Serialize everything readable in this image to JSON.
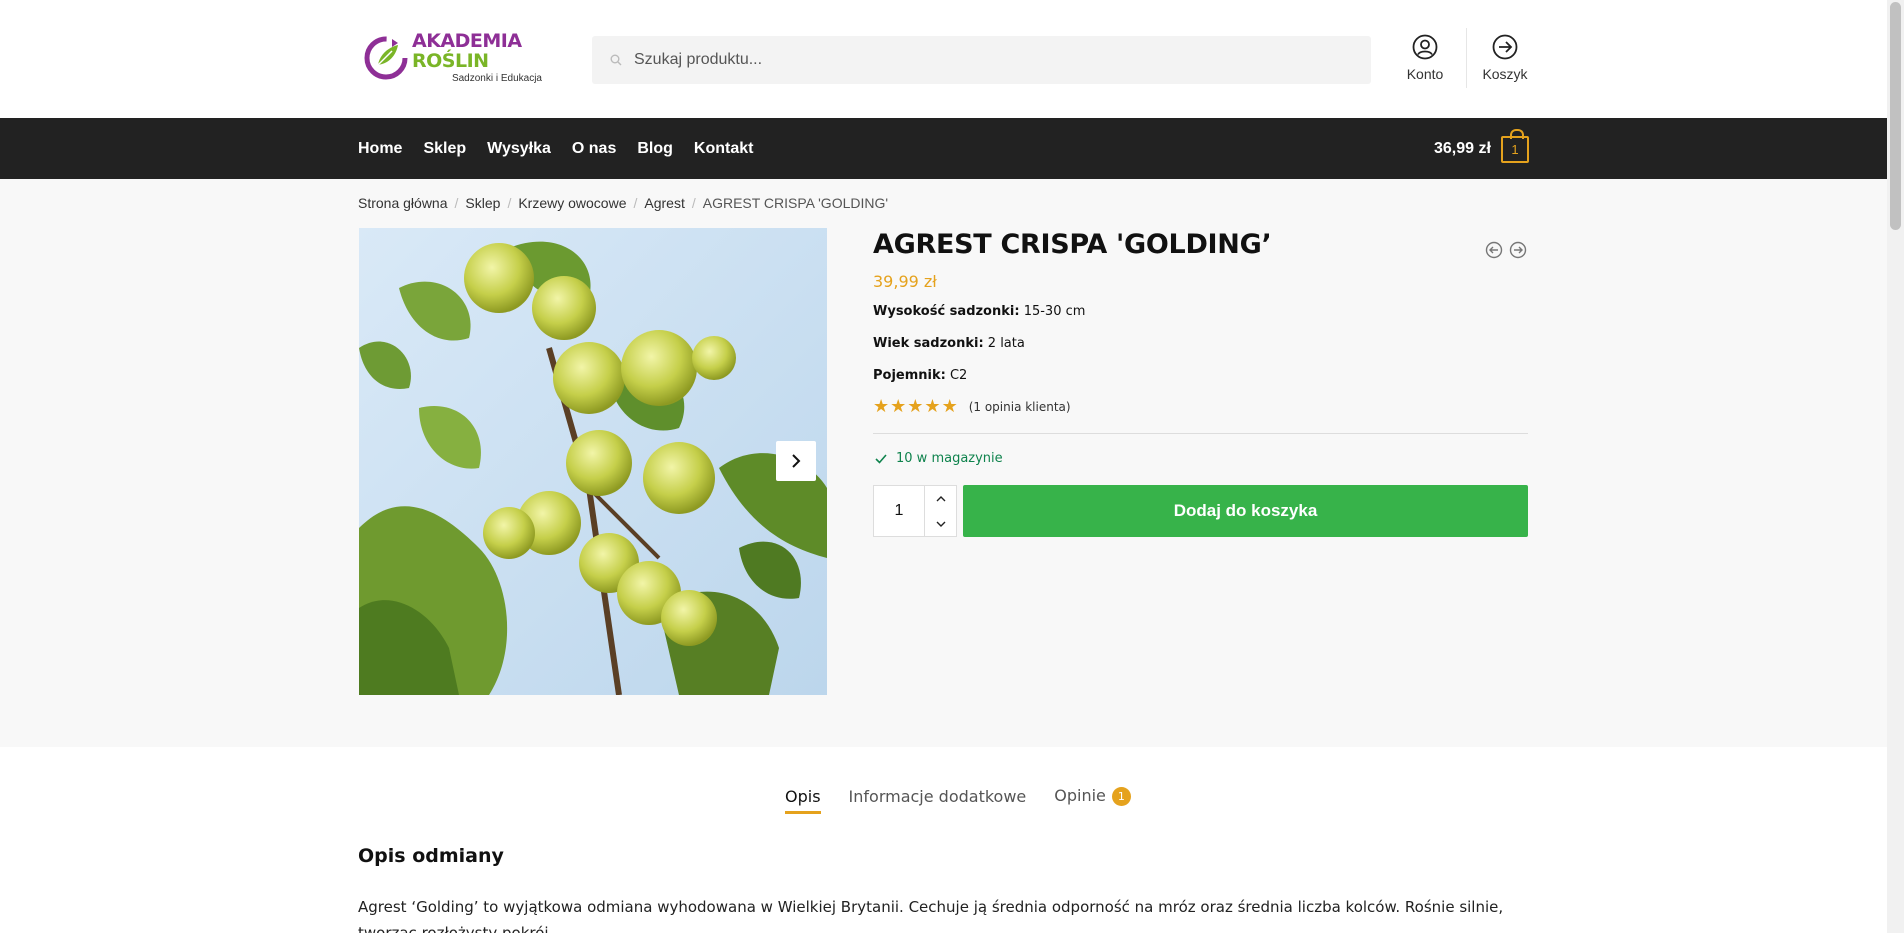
{
  "header": {
    "logo": {
      "title_part1": "AKADEMIA ",
      "title_part2": "ROŚLIN",
      "subtitle": "Sadzonki i Edukacja"
    },
    "search": {
      "placeholder": "Szukaj produktu..."
    },
    "account_label": "Konto",
    "cart_label": "Koszyk"
  },
  "nav": {
    "items": [
      "Home",
      "Sklep",
      "Wysyłka",
      "O nas",
      "Blog",
      "Kontakt"
    ],
    "cart_total": "36,99 zł",
    "cart_count": "1"
  },
  "breadcrumb": [
    "Strona główna",
    "Sklep",
    "Krzewy owocowe",
    "Agrest",
    "AGREST CRISPA 'GOLDING'"
  ],
  "product": {
    "title": "AGREST CRISPA 'GOLDING’",
    "price": "39,99 zł",
    "attributes": [
      {
        "label": "Wysokość sadzonki:",
        "value": "15-30 cm"
      },
      {
        "label": "Wiek sadzonki:",
        "value": "2 lata"
      },
      {
        "label": "Pojemnik:",
        "value": "C2"
      }
    ],
    "rating": 5,
    "reviews_text": "(1 opinia klienta)",
    "stock": "10 w magazynie",
    "quantity": "1",
    "add_to_cart": "Dodaj do koszyka"
  },
  "tabs": [
    {
      "label": "Opis"
    },
    {
      "label": "Informacje dodatkowe"
    },
    {
      "label": "Opinie",
      "badge": "1"
    }
  ],
  "description": {
    "heading": "Opis odmiany",
    "text": "Agrest ‘Golding’ to wyjątkowa odmiana wyhodowana w Wielkiej Brytanii. Cechuje ją średnia odporność na mróz oraz średnia liczba kolców. Rośnie silnie, tworząc rozłożysty pokrój."
  },
  "colors": {
    "accent": "#e5a21d",
    "button": "#37b34a",
    "navbar": "#222222",
    "stock": "#0f834d"
  }
}
